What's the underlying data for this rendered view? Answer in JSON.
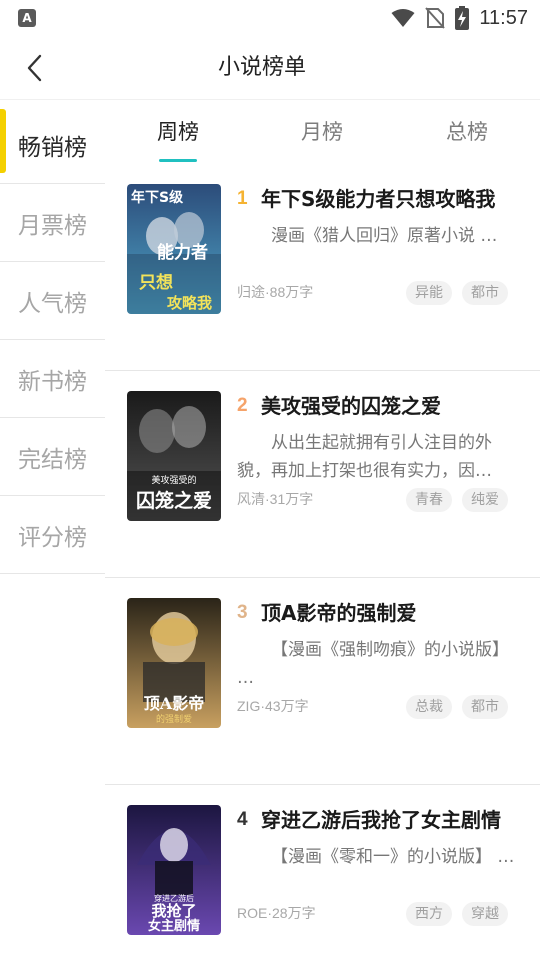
{
  "status_bar": {
    "time": "11:57",
    "left_icon_letter": "A"
  },
  "header": {
    "title": "小说榜单"
  },
  "sidebar": {
    "items": [
      {
        "label": "畅销榜",
        "active": true
      },
      {
        "label": "月票榜",
        "active": false
      },
      {
        "label": "人气榜",
        "active": false
      },
      {
        "label": "新书榜",
        "active": false
      },
      {
        "label": "完结榜",
        "active": false
      },
      {
        "label": "评分榜",
        "active": false
      }
    ]
  },
  "tabs": [
    {
      "label": "周榜",
      "active": true
    },
    {
      "label": "月榜",
      "active": false
    },
    {
      "label": "总榜",
      "active": false
    }
  ],
  "books": [
    {
      "rank": "1",
      "rank_color": "#f5b332",
      "title": "年下S级能力者只想攻略我",
      "desc": "漫画《猎人回归》原著小说 …",
      "meta": "归途·88万字",
      "tags": [
        "异能",
        "都市"
      ],
      "cover_text": [
        "年下S级",
        "能力者",
        "只想",
        "攻略我"
      ],
      "cover_colors": [
        "#2c4c7a",
        "#4fa6c8"
      ]
    },
    {
      "rank": "2",
      "rank_color": "#f5a36a",
      "title": "美攻强受的囚笼之爱",
      "desc": "从出生起就拥有引人注目的外貌，再加上打架也很有实力，因…",
      "meta": "风清·31万字",
      "tags": [
        "青春",
        "纯爱"
      ],
      "cover_text": [
        "美攻强受的",
        "囚笼之爱"
      ],
      "cover_colors": [
        "#1a1a1a",
        "#555555"
      ]
    },
    {
      "rank": "3",
      "rank_color": "#e0b48a",
      "title": "顶A影帝的强制爱",
      "desc": "【漫画《强制吻痕》的小说版】 …",
      "meta": "ZIG·43万字",
      "tags": [
        "总裁",
        "都市"
      ],
      "cover_text": [
        "顶A影帝",
        "的强制爱"
      ],
      "cover_colors": [
        "#2a2418",
        "#c8a060"
      ]
    },
    {
      "rank": "4",
      "rank_color": "#333333",
      "title": "穿进乙游后我抢了女主剧情",
      "desc": "【漫画《零和一》的小说版】 …",
      "meta": "ROE·28万字",
      "tags": [
        "西方",
        "穿越"
      ],
      "cover_text": [
        "穿进乙游后",
        "我抢了",
        "女主剧情"
      ],
      "cover_colors": [
        "#1c1640",
        "#6a48b0"
      ]
    }
  ]
}
